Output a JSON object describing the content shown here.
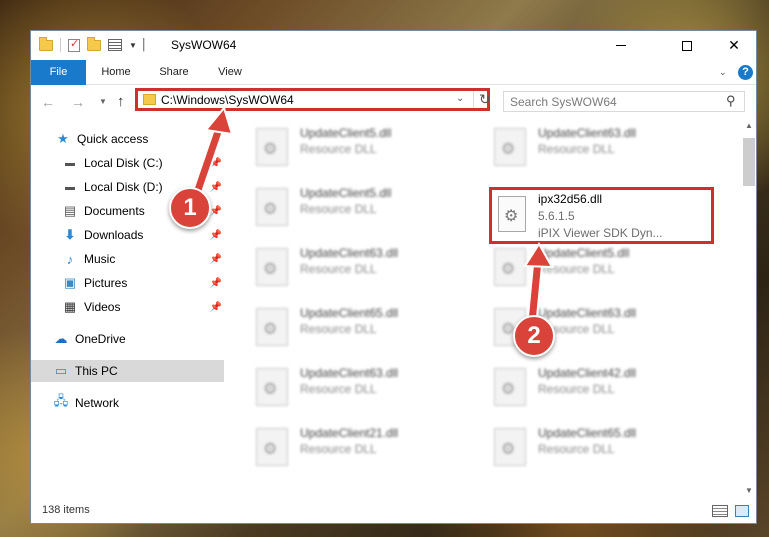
{
  "window": {
    "title": "SysWOW64",
    "maximize_glyph": "□",
    "close_glyph": "✕"
  },
  "ribbon": {
    "tabs": [
      "File",
      "Home",
      "Share",
      "View"
    ],
    "help": "?"
  },
  "navigation": {
    "address": "C:\\Windows\\SysWOW64",
    "search_placeholder": "Search SysWOW64"
  },
  "sidebar": {
    "items": [
      {
        "label": "Quick access",
        "icon": "star-icon",
        "pinned": false
      },
      {
        "label": "Local Disk (C:)",
        "icon": "drive-icon",
        "pinned": true
      },
      {
        "label": "Local Disk (D:)",
        "icon": "drive-icon",
        "pinned": true
      },
      {
        "label": "Documents",
        "icon": "documents-icon",
        "pinned": true
      },
      {
        "label": "Downloads",
        "icon": "download-icon",
        "pinned": true
      },
      {
        "label": "Music",
        "icon": "music-icon",
        "pinned": true
      },
      {
        "label": "Pictures",
        "icon": "pictures-icon",
        "pinned": true
      },
      {
        "label": "Videos",
        "icon": "videos-icon",
        "pinned": true
      },
      {
        "label": "OneDrive",
        "icon": "cloud-icon",
        "pinned": false
      },
      {
        "label": "This PC",
        "icon": "computer-icon",
        "pinned": false,
        "selected": true
      },
      {
        "label": "Network",
        "icon": "network-icon",
        "pinned": false
      }
    ]
  },
  "files": [
    {
      "name": "UpdateClient5.dll",
      "desc": "Resource DLL"
    },
    {
      "name": "UpdateClient63.dll",
      "desc": "Resource DLL"
    },
    {
      "name": "UpdateClient5.dll",
      "desc": "Resource DLL"
    },
    {
      "name": "UpdateClient63.dll",
      "desc": "Resource DLL"
    },
    {
      "name": "UpdateClient5.dll",
      "desc": "Resource DLL"
    },
    {
      "name": "UpdateClient65.dll",
      "desc": "Resource DLL"
    },
    {
      "name": "UpdateClient63.dll",
      "desc": "Resource DLL"
    },
    {
      "name": "UpdateClient63.dll",
      "desc": "Resource DLL"
    },
    {
      "name": "UpdateClient42.dll",
      "desc": "Resource DLL"
    },
    {
      "name": "UpdateClient21.dll",
      "desc": "Resource DLL"
    },
    {
      "name": "UpdateClient65.dll",
      "desc": "Resource DLL"
    }
  ],
  "highlighted_file": {
    "name": "ipx32d56.dll",
    "version": "5.6.1.5",
    "description": "iPIX Viewer SDK Dyn..."
  },
  "status": {
    "item_count": "138 items"
  },
  "annotations": {
    "step1": "1",
    "step2": "2",
    "color": "#d9433a"
  }
}
